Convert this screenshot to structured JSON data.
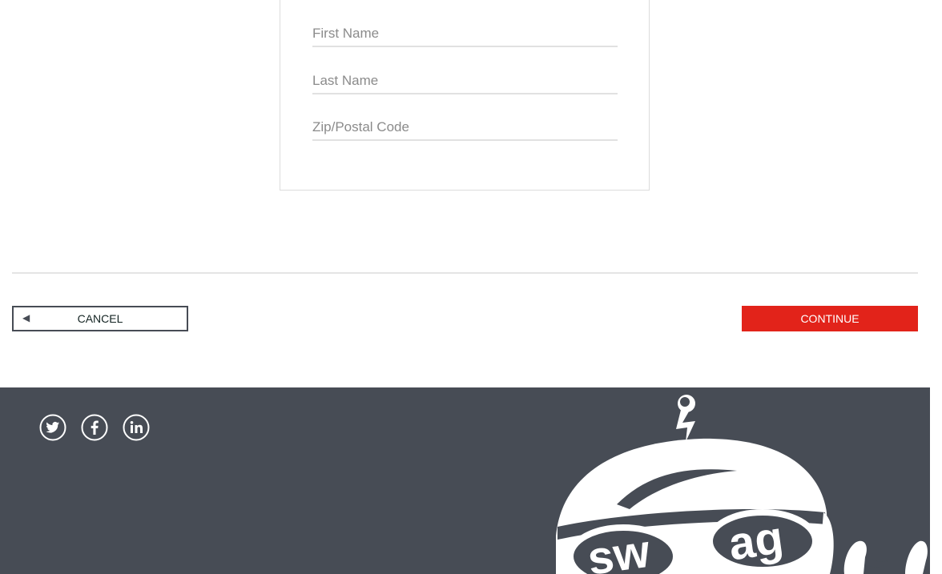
{
  "form": {
    "first_name_placeholder": "First Name",
    "last_name_placeholder": "Last Name",
    "zip_placeholder": "Zip/Postal Code"
  },
  "actions": {
    "cancel_label": "CANCEL",
    "cancel_icon": "◀",
    "continue_label": "CONTINUE"
  },
  "footer": {
    "social": [
      {
        "name": "twitter-icon"
      },
      {
        "name": "facebook-icon"
      },
      {
        "name": "linkedin-icon"
      }
    ],
    "mascot_text": "swag"
  },
  "colors": {
    "accent": "#e2231a",
    "footer_bg": "#474c55",
    "border": "#dcdcdc"
  }
}
